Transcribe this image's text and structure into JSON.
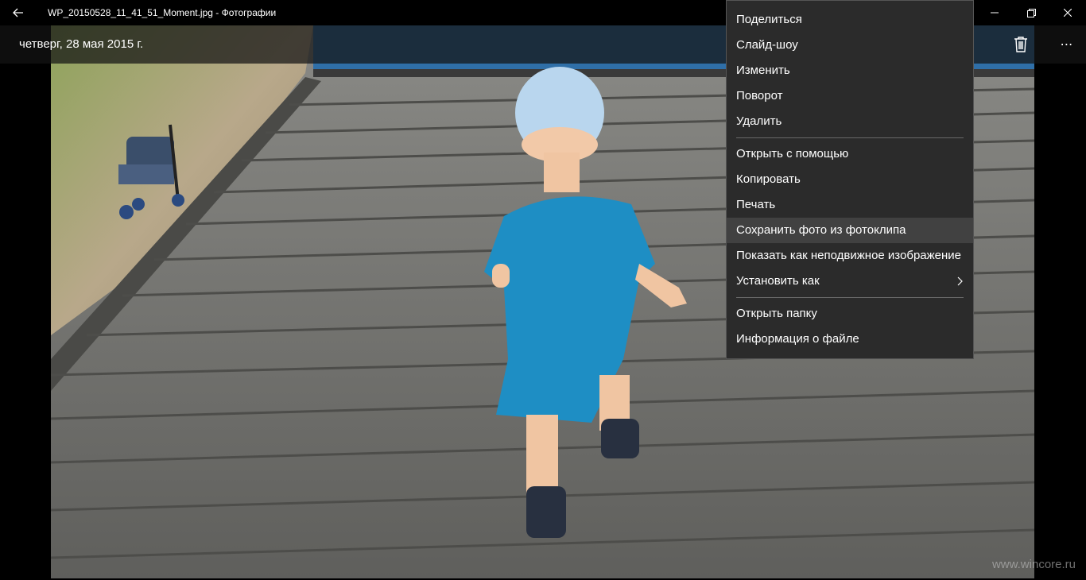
{
  "window": {
    "title": "WP_20150528_11_41_51_Moment.jpg - Фотографии"
  },
  "titlebar": {
    "back_icon": "arrow-left-icon",
    "minimize_icon": "minimize-icon",
    "restore_icon": "restore-icon",
    "close_icon": "close-icon"
  },
  "infobar": {
    "date": "четверг, 28 мая 2015 г.",
    "delete_icon": "trash-icon",
    "more_label": "⋯"
  },
  "menu": {
    "items": [
      {
        "label": "Поделиться"
      },
      {
        "label": "Слайд-шоу"
      },
      {
        "label": "Изменить"
      },
      {
        "label": "Поворот"
      },
      {
        "label": "Удалить"
      },
      {
        "label": "Открыть с помощью"
      },
      {
        "label": "Копировать"
      },
      {
        "label": "Печать"
      },
      {
        "label": "Сохранить фото из фотоклипа"
      },
      {
        "label": "Показать как неподвижное изображение"
      },
      {
        "label": "Установить как"
      },
      {
        "label": "Открыть папку"
      },
      {
        "label": "Информация о файле"
      }
    ],
    "highlighted": "Сохранить фото из фотоклипа",
    "submenu_icon": "chevron-right-icon"
  },
  "watermark": "www.wincore.ru",
  "colors": {
    "menu_bg": "#2b2b2b",
    "menu_hover": "#414141",
    "titlebar_bg": "#000000"
  }
}
